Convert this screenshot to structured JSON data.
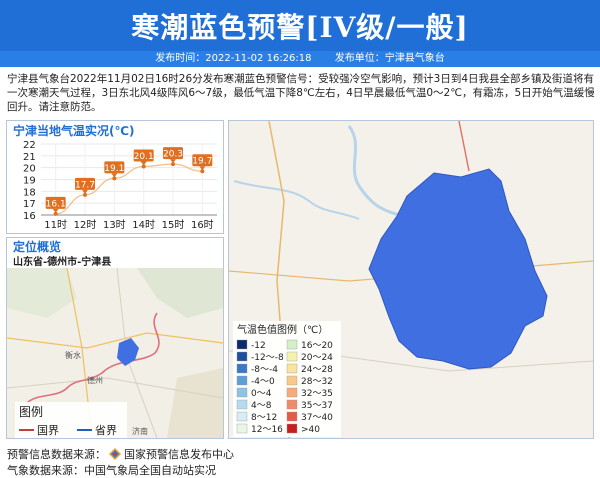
{
  "header": {
    "title": "寒潮蓝色预警[IV级/一般]",
    "publish_time_label": "发布时间：2022-11-02 16:26:18",
    "publisher_label": "发布单位：宁津县气象台"
  },
  "description": "宁津县气象台2022年11月02日16时26分发布寒潮蓝色预警信号：受较强冷空气影响，预计3日到4日我县全部乡镇及街道将有一次寒潮天气过程，3日东北风4级阵风6～7级，最低气温下降8℃左右，4日早晨最低气温0～2℃，有霜冻，5日开始气温缓慢回升。请注意防范。",
  "temperature_panel": {
    "title": "宁津当地气温实况(℃)",
    "accent": "#e07020"
  },
  "chart_data": {
    "type": "line",
    "title": "宁津当地气温实况(℃)",
    "categories": [
      "11时",
      "12时",
      "13时",
      "14时",
      "15时",
      "16时"
    ],
    "values": [
      16.1,
      17.7,
      19.1,
      20.1,
      20.3,
      19.7
    ],
    "yticks": [
      "16",
      "17",
      "18",
      "19",
      "20",
      "21",
      "22"
    ],
    "ylim": [
      16,
      22
    ],
    "grid": true
  },
  "location_panel": {
    "title": "定位概览",
    "region": "山东省-德州市-宁津县",
    "legend_title": "图例",
    "legend_items": [
      {
        "label": "国界",
        "color": "#c04040"
      },
      {
        "label": "省界",
        "color": "#1f5fbf"
      }
    ],
    "place_labels": [
      "德州",
      "衡水",
      "济南"
    ]
  },
  "map_panel": {
    "fill_color": "#3f6fe0",
    "legend_title": "气温色值图例（℃）",
    "legend_left": [
      {
        "label": "-12",
        "color": "#0b2a6e"
      },
      {
        "label": "-12～-8",
        "color": "#1f4f9a"
      },
      {
        "label": "-8～-4",
        "color": "#3b78c4"
      },
      {
        "label": "-4～0",
        "color": "#5f9ed6"
      },
      {
        "label": "0～4",
        "color": "#8ec3e6"
      },
      {
        "label": "4～8",
        "color": "#b5dbf0"
      },
      {
        "label": "8～12",
        "color": "#d6ecf7"
      },
      {
        "label": "12～16",
        "color": "#e9f6e6"
      }
    ],
    "legend_right": [
      {
        "label": "16～20",
        "color": "#d5f0c8"
      },
      {
        "label": "20～24",
        "color": "#f5f2b0"
      },
      {
        "label": "24～28",
        "color": "#fae39b"
      },
      {
        "label": "28～32",
        "color": "#f8c98a"
      },
      {
        "label": "32～35",
        "color": "#f5ab7c"
      },
      {
        "label": "35～37",
        "color": "#f08a6a"
      },
      {
        "label": "37～40",
        "color": "#e45b48"
      },
      {
        "label": ">40",
        "color": "#c81e1e"
      }
    ]
  },
  "footer": {
    "source_label": "预警信息数据来源：",
    "source_name": "国家预警信息发布中心",
    "weather_label": "气象数据来源：",
    "weather_name": "中国气象局全国自动站实况"
  }
}
